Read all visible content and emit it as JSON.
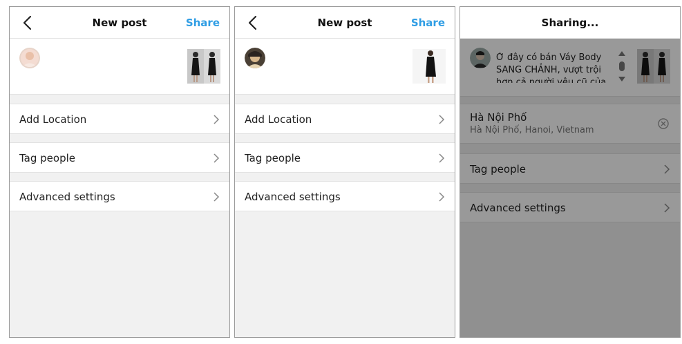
{
  "panels": [
    {
      "header": {
        "title": "New post",
        "share_label": "Share"
      },
      "rows": [
        "Add Location",
        "Tag people",
        "Advanced settings"
      ]
    },
    {
      "header": {
        "title": "New post",
        "share_label": "Share"
      },
      "rows": [
        "Add Location",
        "Tag people",
        "Advanced settings"
      ]
    },
    {
      "header": {
        "title": "Sharing..."
      },
      "caption": "Ở đây có bán Váy Body SANG CHẢNH, vượt trội hơn cả người yêu cũ của",
      "location": {
        "name": "Hà Nội Phố",
        "address": "Hà Nội Phố, Hanoi, Vietnam"
      },
      "rows": [
        "Tag people",
        "Advanced settings"
      ]
    }
  ],
  "colors": {
    "accent": "#2f9de4",
    "background": "#f1f1f1",
    "overlay": "rgba(0,0,0,0.40)"
  },
  "icons": {
    "back": "chevron-left-icon",
    "row": "chevron-right-icon",
    "clear": "clear-circle-icon"
  }
}
